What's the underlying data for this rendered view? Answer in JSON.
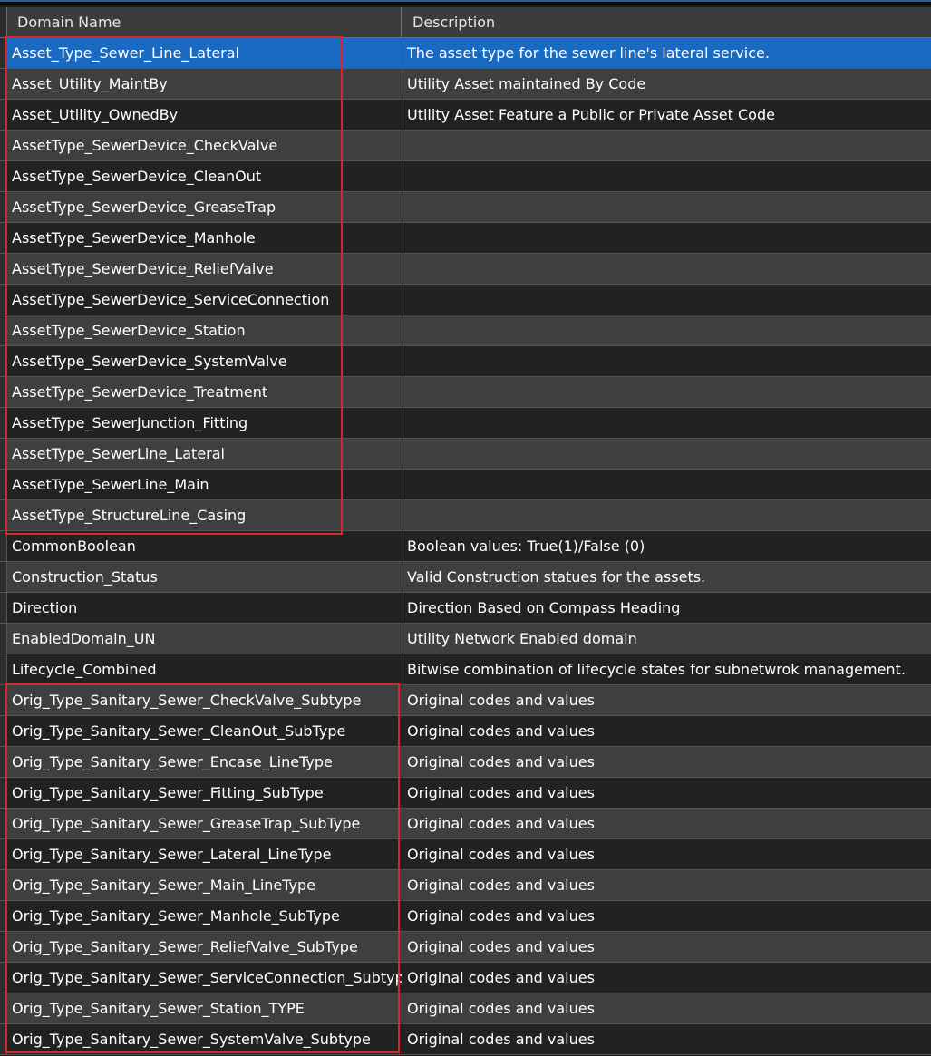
{
  "table": {
    "columns": [
      "Domain Name",
      "Description"
    ],
    "rows": [
      {
        "name": "Asset_Type_Sewer_Line_Lateral",
        "description": "The asset type for the sewer line's lateral service.",
        "selected": true
      },
      {
        "name": "Asset_Utility_MaintBy",
        "description": "Utility Asset maintained By Code"
      },
      {
        "name": "Asset_Utility_OwnedBy",
        "description": "Utility Asset Feature a Public or Private Asset Code"
      },
      {
        "name": "AssetType_SewerDevice_CheckValve",
        "description": ""
      },
      {
        "name": "AssetType_SewerDevice_CleanOut",
        "description": ""
      },
      {
        "name": "AssetType_SewerDevice_GreaseTrap",
        "description": ""
      },
      {
        "name": "AssetType_SewerDevice_Manhole",
        "description": ""
      },
      {
        "name": "AssetType_SewerDevice_ReliefValve",
        "description": ""
      },
      {
        "name": "AssetType_SewerDevice_ServiceConnection",
        "description": ""
      },
      {
        "name": "AssetType_SewerDevice_Station",
        "description": ""
      },
      {
        "name": "AssetType_SewerDevice_SystemValve",
        "description": ""
      },
      {
        "name": "AssetType_SewerDevice_Treatment",
        "description": ""
      },
      {
        "name": "AssetType_SewerJunction_Fitting",
        "description": ""
      },
      {
        "name": "AssetType_SewerLine_Lateral",
        "description": ""
      },
      {
        "name": "AssetType_SewerLine_Main",
        "description": ""
      },
      {
        "name": "AssetType_StructureLine_Casing",
        "description": ""
      },
      {
        "name": "CommonBoolean",
        "description": "Boolean values:  True(1)/False (0)"
      },
      {
        "name": "Construction_Status",
        "description": "Valid Construction statues for the assets."
      },
      {
        "name": "Direction",
        "description": "Direction Based on Compass Heading"
      },
      {
        "name": "EnabledDomain_UN",
        "description": "Utility Network Enabled domain"
      },
      {
        "name": "Lifecycle_Combined",
        "description": "Bitwise combination of lifecycle states for subnetwrok management."
      },
      {
        "name": "Orig_Type_Sanitary_Sewer_CheckValve_Subtype",
        "description": "Original codes and values"
      },
      {
        "name": "Orig_Type_Sanitary_Sewer_CleanOut_SubType",
        "description": "Original codes and values"
      },
      {
        "name": "Orig_Type_Sanitary_Sewer_Encase_LineType",
        "description": "Original codes and values"
      },
      {
        "name": "Orig_Type_Sanitary_Sewer_Fitting_SubType",
        "description": "Original codes and values"
      },
      {
        "name": "Orig_Type_Sanitary_Sewer_GreaseTrap_SubType",
        "description": "Original codes and values"
      },
      {
        "name": "Orig_Type_Sanitary_Sewer_Lateral_LineType",
        "description": "Original codes and values"
      },
      {
        "name": "Orig_Type_Sanitary_Sewer_Main_LineType",
        "description": "Original codes and values"
      },
      {
        "name": "Orig_Type_Sanitary_Sewer_Manhole_SubType",
        "description": "Original codes and values"
      },
      {
        "name": "Orig_Type_Sanitary_Sewer_ReliefValve_SubType",
        "description": "Original codes and values"
      },
      {
        "name": "Orig_Type_Sanitary_Sewer_ServiceConnection_Subtype",
        "description": "Original codes and values"
      },
      {
        "name": "Orig_Type_Sanitary_Sewer_Station_TYPE",
        "description": "Original codes and values"
      },
      {
        "name": "Orig_Type_Sanitary_Sewer_SystemValve_Subtype",
        "description": "Original codes and values"
      }
    ]
  },
  "colors": {
    "selection": "#1b6ac2",
    "annotation_box": "#d8262b"
  }
}
